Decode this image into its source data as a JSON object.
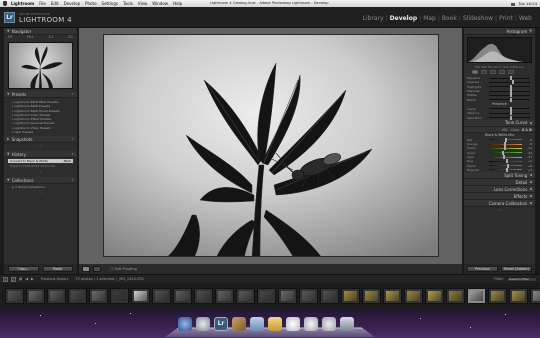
{
  "menubar": {
    "app_name": "Lightroom",
    "items": [
      "File",
      "Edit",
      "Develop",
      "Photo",
      "Settings",
      "Tools",
      "View",
      "Window",
      "Help"
    ],
    "window_title": "Lightroom 4 Catalog.lrcat - Adobe Photoshop Lightroom - Develop",
    "clock": "Tue 16:24"
  },
  "header": {
    "logo_text": "Lr",
    "byline": "ADOBE PHOTOSHOP",
    "product": "LIGHTROOM 4",
    "modules": [
      "Library",
      "Develop",
      "Map",
      "Book",
      "Slideshow",
      "Print",
      "Web"
    ],
    "active_module": "Develop",
    "separator": "|"
  },
  "left_panel": {
    "navigator": {
      "title": "Navigator",
      "zoom_options": [
        "FIT",
        "FILL",
        "1:1",
        "3:1"
      ]
    },
    "presets": {
      "title": "Presets",
      "items": [
        "Lightroom B&W Filter Presets",
        "Lightroom B&W Presets",
        "Lightroom B&W Toned Presets",
        "Lightroom Color Presets",
        "Lightroom Effect Presets",
        "Lightroom General Presets",
        "Lightroom Video Presets",
        "User Presets"
      ]
    },
    "snapshots": {
      "title": "Snapshots"
    },
    "history": {
      "title": "History",
      "items": [
        {
          "label": "Convert to Black & White",
          "value": "B&W",
          "selected": true
        },
        {
          "label": "Import (13/01/2012 11:03:30)",
          "value": "",
          "selected": false
        }
      ]
    },
    "collections": {
      "title": "Collections",
      "items": [
        "Smart Collections"
      ]
    },
    "buttons": {
      "copy": "Copy...",
      "paste": "Paste"
    }
  },
  "right_panel": {
    "histogram": {
      "title": "Histogram",
      "info": "ISO 200   50 mm   f / 5.6   1/250 sec"
    },
    "basic_sliders": [
      "Exposure",
      "Contrast",
      "Highlights",
      "Shadows",
      "Whites",
      "Blacks"
    ],
    "presence": {
      "title": "Presence",
      "sliders": [
        "Clarity",
        "Vibrance",
        "Saturation"
      ]
    },
    "tone_curve": {
      "title": "Tone Curve"
    },
    "hsl": {
      "tabs": [
        "HSL",
        "Color",
        "B & W"
      ],
      "active": "B & W"
    },
    "bw_mix": {
      "title": "Black & White Mix",
      "sliders": [
        {
          "label": "Red",
          "value": "-6"
        },
        {
          "label": "Orange",
          "value": "-8"
        },
        {
          "label": "Yellow",
          "value": "-11"
        },
        {
          "label": "Green",
          "value": "-23"
        },
        {
          "label": "Aqua",
          "value": "-17"
        },
        {
          "label": "Blue",
          "value": "+7"
        },
        {
          "label": "Purple",
          "value": "+8"
        },
        {
          "label": "Magenta",
          "value": "+3"
        }
      ]
    },
    "sections": [
      "Split Toning",
      "Detail",
      "Lens Corrections",
      "Effects",
      "Camera Calibration"
    ],
    "buttons": {
      "previous": "Previous",
      "reset": "Reset (Adobe)"
    }
  },
  "toolbar": {
    "soft_proofing": "Soft Proofing"
  },
  "filmstrip_bar": {
    "pages": [
      "1",
      "2"
    ],
    "source": "Previous Import",
    "count": "75 photos / 1 selected / _MG_1344.CR2",
    "filter_label": "Filter:",
    "filter_value": "Custom Filter"
  },
  "filmstrip": {
    "selected_index": 22
  },
  "colors": {
    "accent_lr_blue": "#3a5a7a",
    "panel_bg": "#2d2d2d",
    "canvas_bg": "#626262",
    "active_module": "#f0f0f0"
  }
}
